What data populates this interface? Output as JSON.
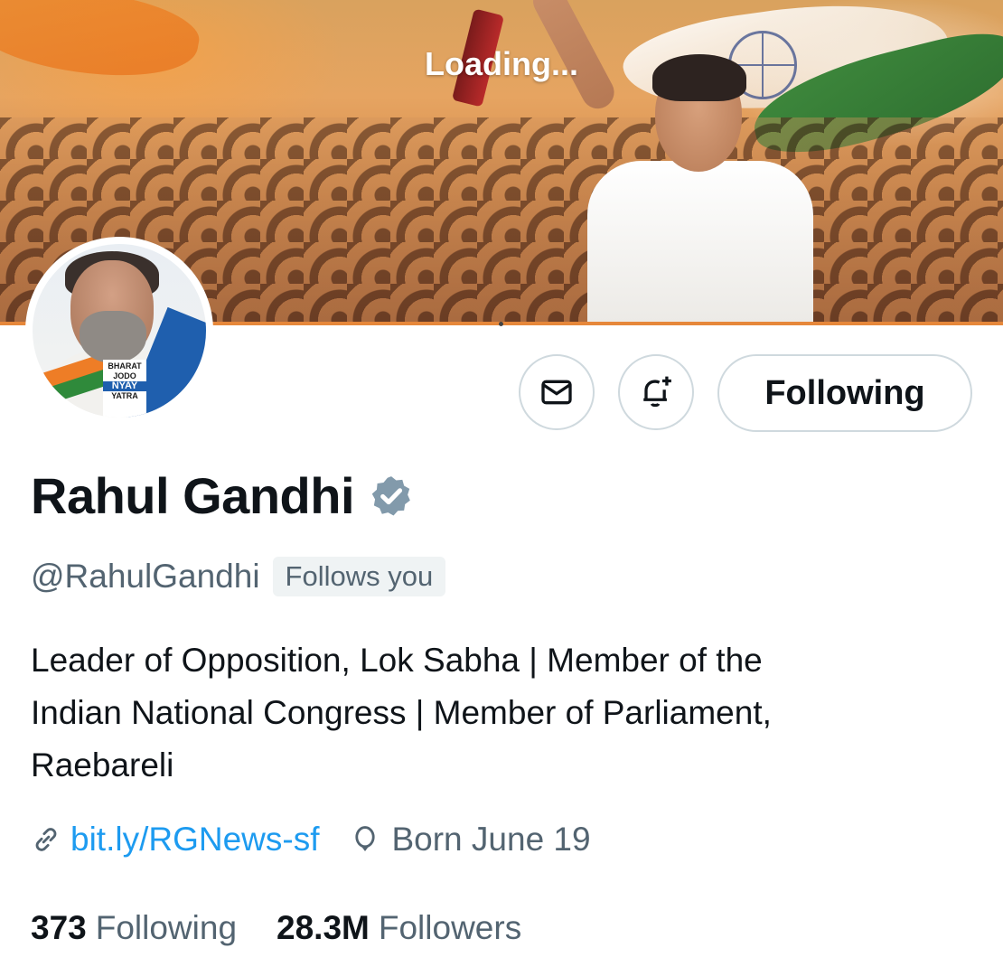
{
  "banner": {
    "loading_text": "Loading..."
  },
  "avatar": {
    "logo_lines": [
      "BHARAT",
      "JODO",
      "NYAY",
      "YATRA"
    ]
  },
  "actions": {
    "message_icon": "mail-icon",
    "notify_icon": "bell-plus-icon",
    "follow_label": "Following"
  },
  "profile": {
    "name": "Rahul Gandhi",
    "verified_icon": "verified-badge-icon",
    "verified_color": "#829aab",
    "handle": "@RahulGandhi",
    "follows_you": "Follows you",
    "bio_lines": [
      "Leader of Opposition, Lok Sabha | Member of the",
      "Indian National Congress | Member of Parliament,",
      "Raebareli"
    ],
    "link_icon": "link-icon",
    "link": "bit.ly/RGNews-sf",
    "link_color": "#1d9bf0",
    "birthday_icon": "balloon-icon",
    "born": "Born June 19"
  },
  "stats": {
    "following_count": "373",
    "following_label": "Following",
    "followers_count": "28.3M",
    "followers_label": "Followers"
  }
}
